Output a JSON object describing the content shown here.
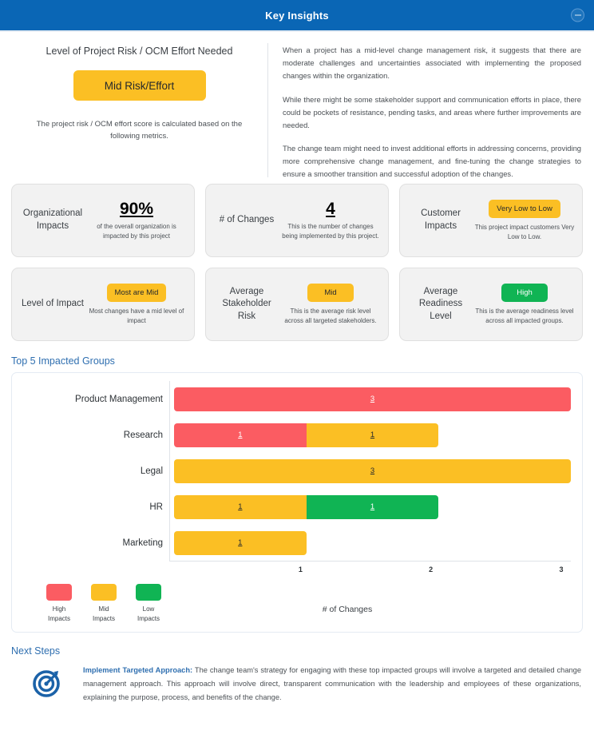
{
  "header": {
    "title": "Key Insights",
    "collapse_icon": "minus-circle-icon"
  },
  "risk_panel": {
    "heading": "Level of Project Risk / OCM Effort Needed",
    "pill_label": "Mid Risk/Effort",
    "pill_color": "#fbbf24",
    "note": "The project risk / OCM effort score is calculated based on the following metrics."
  },
  "description": {
    "paragraphs": [
      "When a project has a mid-level change management risk, it suggests that there are moderate challenges and uncertainties associated with implementing the proposed changes within the organization.",
      "While there might be some stakeholder support and communication efforts in place, there could be pockets of resistance, pending tasks, and areas where further improvements are needed.",
      "The change team might need to invest additional efforts in addressing concerns, providing more comprehensive change management, and fine-tuning the change strategies to ensure a smoother transition and successful adoption of the changes."
    ]
  },
  "metric_cards": [
    {
      "label": "Organizational Impacts",
      "value": "90%",
      "badge": null,
      "badge_style": null,
      "sub": "of the overall organization is impacted by this project"
    },
    {
      "label": "# of Changes",
      "value": "4",
      "badge": null,
      "badge_style": null,
      "sub": "This is the number of changes being implemented by this project."
    },
    {
      "label": "Customer Impacts",
      "value": null,
      "badge": "Very Low to Low",
      "badge_style": "amber",
      "sub": "This project impact customers Very Low to Low."
    },
    {
      "label": "Level of Impact",
      "value": null,
      "badge": "Most are Mid",
      "badge_style": "amber",
      "sub": "Most changes have a mid level of impact"
    },
    {
      "label": "Average Stakeholder Risk",
      "value": null,
      "badge": "Mid",
      "badge_style": "amber",
      "sub": "This is the average risk level across all targeted stakeholders."
    },
    {
      "label": "Average Readiness Level",
      "value": null,
      "badge": "High",
      "badge_style": "green",
      "sub": "This is the average readiness level across all impacted groups."
    }
  ],
  "chart_section": {
    "title": "Top 5 Impacted Groups"
  },
  "chart_data": {
    "type": "bar",
    "orientation": "horizontal",
    "stacked": true,
    "title": "Top 5 Impacted Groups",
    "xlabel": "# of Changes",
    "ylabel": "",
    "xlim": [
      0,
      3
    ],
    "xticks": [
      1,
      2,
      3
    ],
    "grid": false,
    "legend_position": "bottom-left",
    "categories": [
      "Product Management",
      "Research",
      "Legal",
      "HR",
      "Marketing"
    ],
    "series": [
      {
        "name": "High Impacts",
        "color": "#fb5c62",
        "values": [
          3,
          1,
          0,
          0,
          0
        ]
      },
      {
        "name": "Mid Impacts",
        "color": "#fbbf24",
        "values": [
          0,
          1,
          3,
          1,
          1
        ]
      },
      {
        "name": "Low Impacts",
        "color": "#10b454",
        "values": [
          0,
          0,
          0,
          1,
          0
        ]
      }
    ],
    "bars": [
      {
        "category": "Product Management",
        "segments": [
          {
            "series": "High Impacts",
            "value": 3,
            "label": "3"
          }
        ]
      },
      {
        "category": "Research",
        "segments": [
          {
            "series": "High Impacts",
            "value": 1,
            "label": "1"
          },
          {
            "series": "Mid Impacts",
            "value": 1,
            "label": "1"
          }
        ]
      },
      {
        "category": "Legal",
        "segments": [
          {
            "series": "Mid Impacts",
            "value": 3,
            "label": "3"
          }
        ]
      },
      {
        "category": "HR",
        "segments": [
          {
            "series": "Mid Impacts",
            "value": 1,
            "label": "1"
          },
          {
            "series": "Low Impacts",
            "value": 1,
            "label": "1"
          }
        ]
      },
      {
        "category": "Marketing",
        "segments": [
          {
            "series": "Mid Impacts",
            "value": 1,
            "label": "1"
          }
        ]
      }
    ],
    "legend": [
      {
        "label_line1": "High",
        "label_line2": "Impacts",
        "color": "#fb5c62"
      },
      {
        "label_line1": "Mid",
        "label_line2": "Impacts",
        "color": "#fbbf24"
      },
      {
        "label_line1": "Low",
        "label_line2": "Impacts",
        "color": "#10b454"
      }
    ]
  },
  "next_steps": {
    "title": "Next Steps",
    "icon": "target-bullseye-icon",
    "item_heading": "Implement Targeted Approach:",
    "item_text": " The change team's strategy for engaging with these top impacted groups will involve a targeted and detailed change management approach. This approach will involve direct, transparent communication with the leadership and employees of these organizations, explaining the purpose, process, and benefits of the change."
  },
  "colors": {
    "header_blue": "#0a66b5",
    "accent_blue": "#2f6fb0",
    "high": "#fb5c62",
    "mid": "#fbbf24",
    "low": "#10b454",
    "card_bg": "#f2f2f2"
  }
}
